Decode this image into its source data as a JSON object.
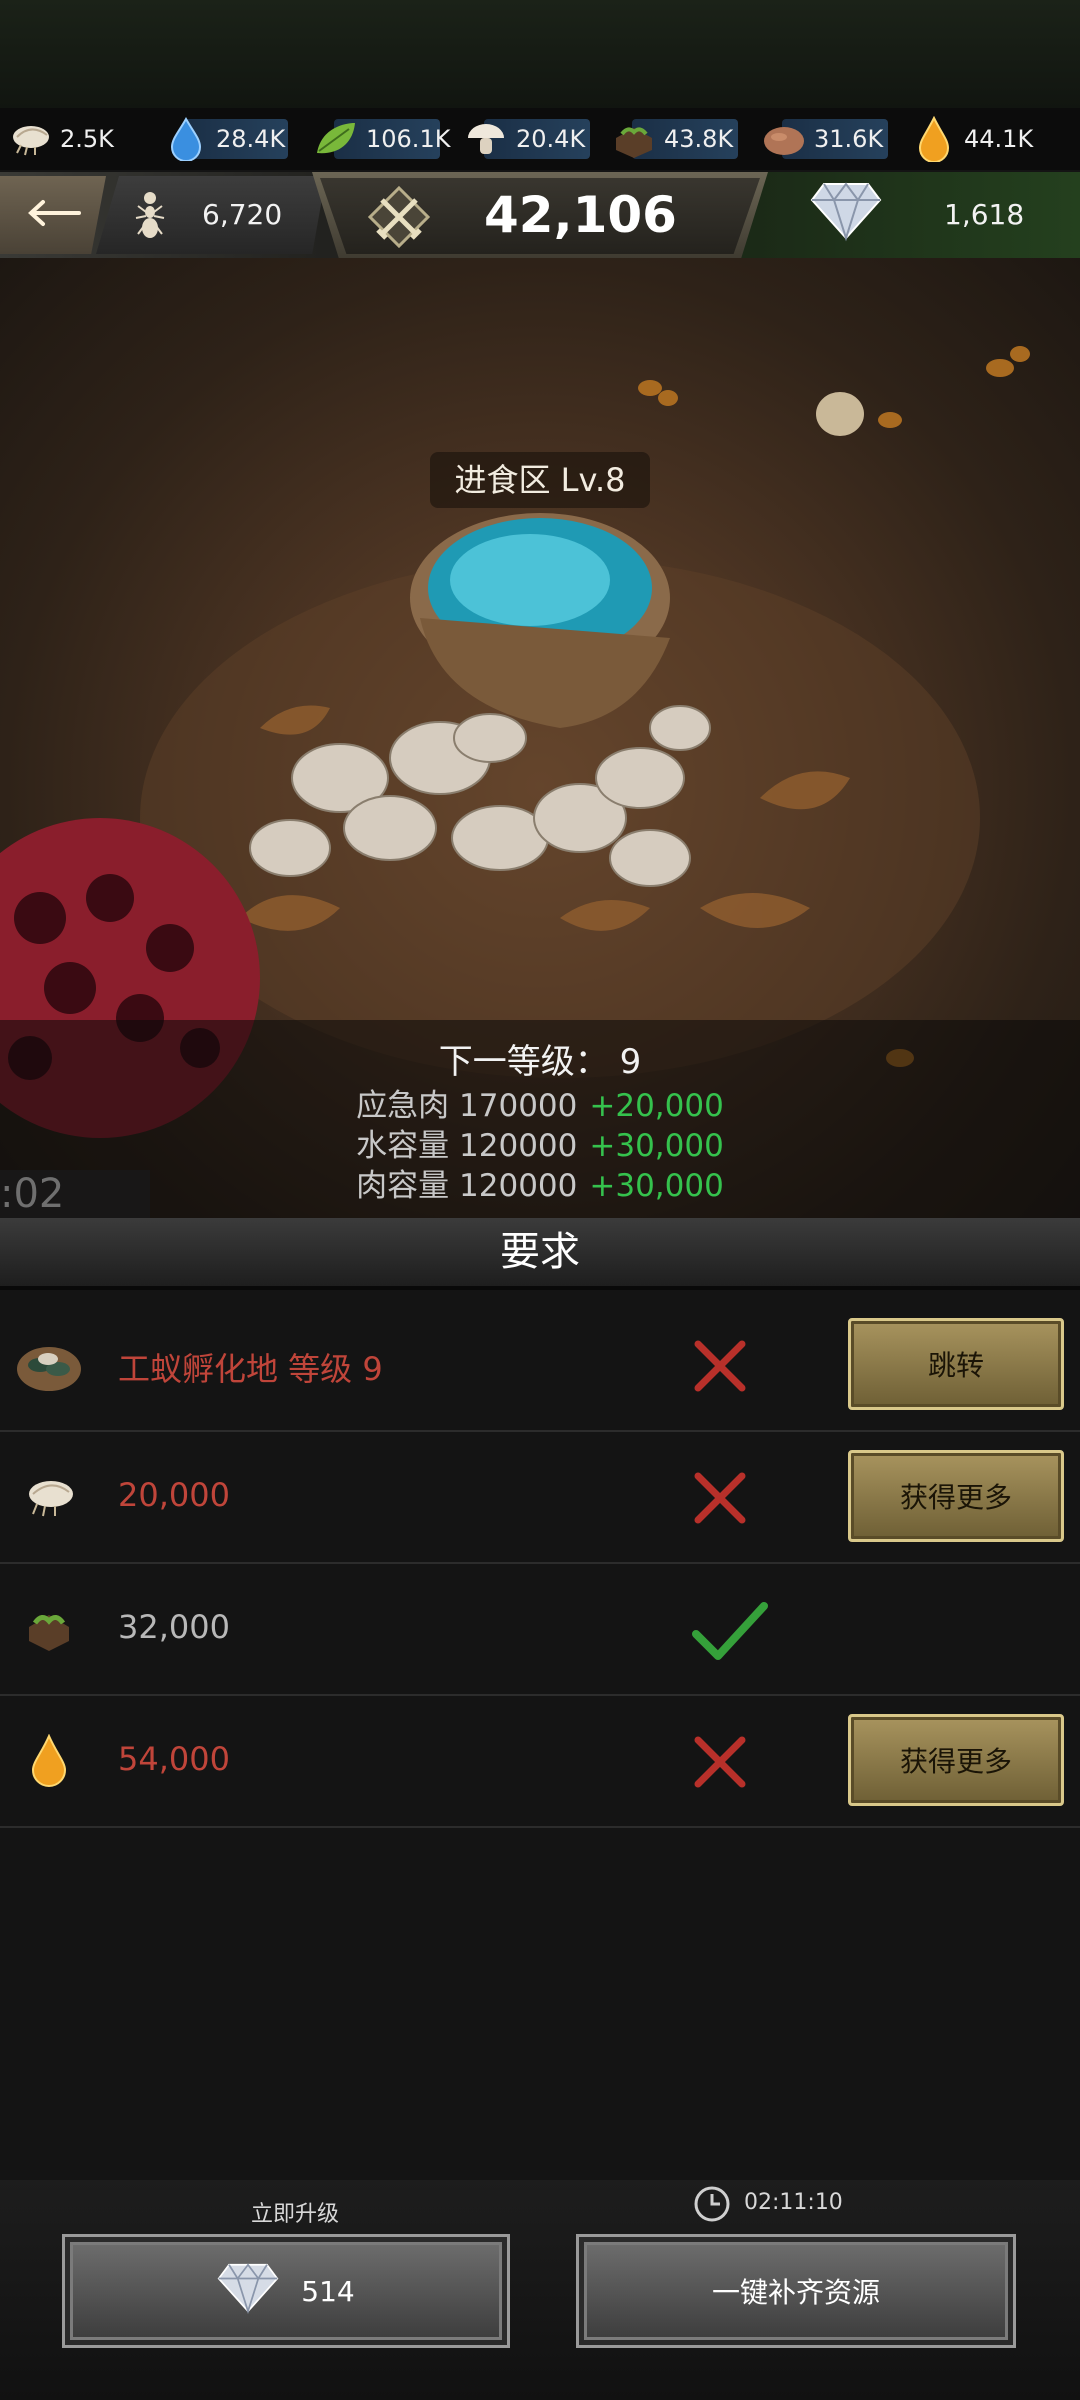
{
  "resources": [
    {
      "icon": "larva-icon",
      "value": "2.5K"
    },
    {
      "icon": "water-drop-icon",
      "value": "28.4K"
    },
    {
      "icon": "leaf-icon",
      "value": "106.1K"
    },
    {
      "icon": "mushroom-icon",
      "value": "20.4K"
    },
    {
      "icon": "soil-icon",
      "value": "43.8K"
    },
    {
      "icon": "sand-icon",
      "value": "31.6K"
    },
    {
      "icon": "honeydew-icon",
      "value": "44.1K"
    }
  ],
  "header": {
    "ant_count": "6,720",
    "power": "42,106",
    "diamonds": "1,618"
  },
  "building": {
    "label": "进食区 Lv.8",
    "next_level": "下一等级： 9",
    "stats": [
      {
        "label": "应急肉 170000",
        "add": "+20,000"
      },
      {
        "label": "水容量 120000",
        "add": "+30,000"
      },
      {
        "label": "肉容量 120000",
        "add": "+30,000"
      }
    ],
    "timer_fragment": ":02"
  },
  "requirements": {
    "title": "要求",
    "rows": [
      {
        "icon": "hatchery-icon",
        "text": "工蚁孵化地 等级 9",
        "met": false,
        "button": "跳转"
      },
      {
        "icon": "larva-icon",
        "text": "20,000",
        "met": false,
        "button": "获得更多"
      },
      {
        "icon": "soil-icon",
        "text": "32,000",
        "met": true,
        "button": ""
      },
      {
        "icon": "honeydew-icon",
        "text": "54,000",
        "met": false,
        "button": "获得更多"
      }
    ]
  },
  "bottom": {
    "instant_label": "立即升级",
    "instant_cost": "514",
    "time": "02:11:10",
    "refill_label": "一键补齐资源"
  },
  "colors": {
    "unmet_text": "#c0453a",
    "met_check": "#35a03a",
    "bonus_green": "#35c24d",
    "gold_button": "#a8945e"
  }
}
